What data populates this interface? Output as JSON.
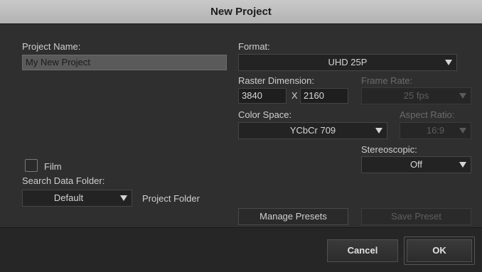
{
  "window": {
    "title": "New Project"
  },
  "project_name": {
    "label": "Project Name:",
    "value": "My New Project"
  },
  "format": {
    "label": "Format:",
    "selected": "UHD 25P"
  },
  "raster": {
    "label": "Raster Dimension:",
    "width": "3840",
    "separator": "X",
    "height": "2160"
  },
  "frame_rate": {
    "label": "Frame Rate:",
    "selected": "25 fps",
    "enabled": false
  },
  "color_space": {
    "label": "Color Space:",
    "selected": "YCbCr 709"
  },
  "aspect_ratio": {
    "label": "Aspect Ratio:",
    "selected": "16:9",
    "enabled": false
  },
  "stereoscopic": {
    "label": "Stereoscopic:",
    "selected": "Off"
  },
  "film": {
    "label": "Film",
    "checked": false
  },
  "search_data_folder": {
    "label": "Search Data Folder:",
    "selected": "Default",
    "side_label": "Project Folder"
  },
  "presets": {
    "manage_label": "Manage Presets",
    "save_label": "Save Preset",
    "save_enabled": false
  },
  "footer": {
    "cancel_label": "Cancel",
    "ok_label": "OK"
  }
}
